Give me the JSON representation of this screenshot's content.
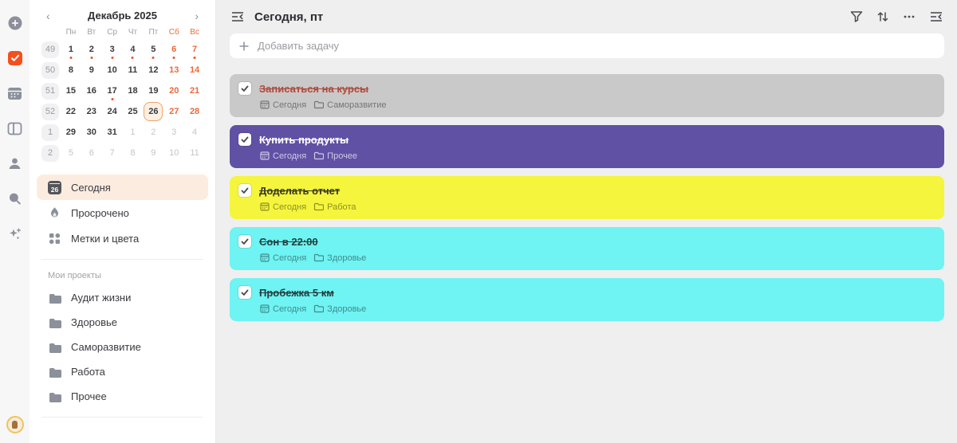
{
  "colors": {
    "accent_orange": "#f4501e",
    "weekend_orange": "#ec6a3a",
    "event_dot_red": "#e85230",
    "selected_day_border": "#f0a468",
    "selected_day_bg": "#fcf1e4",
    "today_nav_highlight": "#fcece0",
    "rail_bg": "#f7f7f8",
    "sidebar_bg": "#ffffff",
    "main_bg": "#efefef"
  },
  "rail": {
    "icons": [
      "add-circle-icon",
      "tasks-check-icon-active",
      "calendar-icon",
      "kanban-board-icon",
      "contacts-icon",
      "search-icon",
      "ai-sparkles-icon"
    ],
    "avatar": "user-avatar"
  },
  "calendar": {
    "title": "Декабрь 2025",
    "prev_glyph": "‹",
    "next_glyph": "›",
    "weekdays": [
      {
        "label": "Пн",
        "weekend": false
      },
      {
        "label": "Вт",
        "weekend": false
      },
      {
        "label": "Ср",
        "weekend": false
      },
      {
        "label": "Чт",
        "weekend": false
      },
      {
        "label": "Пт",
        "weekend": false
      },
      {
        "label": "Сб",
        "weekend": true
      },
      {
        "label": "Вс",
        "weekend": true
      }
    ],
    "weeks": [
      {
        "num": "49",
        "days": [
          {
            "d": "1",
            "dot": true
          },
          {
            "d": "2",
            "dot": true
          },
          {
            "d": "3",
            "dot": true
          },
          {
            "d": "4",
            "dot": true
          },
          {
            "d": "5",
            "dot": true
          },
          {
            "d": "6",
            "dot": true,
            "we": true
          },
          {
            "d": "7",
            "dot": true,
            "we": true
          }
        ]
      },
      {
        "num": "50",
        "days": [
          {
            "d": "8"
          },
          {
            "d": "9"
          },
          {
            "d": "10"
          },
          {
            "d": "11"
          },
          {
            "d": "12"
          },
          {
            "d": "13",
            "we": true
          },
          {
            "d": "14",
            "we": true
          }
        ]
      },
      {
        "num": "51",
        "days": [
          {
            "d": "15"
          },
          {
            "d": "16"
          },
          {
            "d": "17",
            "dot": true
          },
          {
            "d": "18"
          },
          {
            "d": "19"
          },
          {
            "d": "20",
            "we": true
          },
          {
            "d": "21",
            "we": true
          }
        ]
      },
      {
        "num": "52",
        "days": [
          {
            "d": "22"
          },
          {
            "d": "23"
          },
          {
            "d": "24"
          },
          {
            "d": "25"
          },
          {
            "d": "26",
            "sel": true
          },
          {
            "d": "27",
            "we": true
          },
          {
            "d": "28",
            "we": true
          }
        ]
      },
      {
        "num": "1",
        "days": [
          {
            "d": "29"
          },
          {
            "d": "30"
          },
          {
            "d": "31"
          },
          {
            "d": "1",
            "mu": true
          },
          {
            "d": "2",
            "mu": true
          },
          {
            "d": "3",
            "mu": true
          },
          {
            "d": "4",
            "mu": true
          }
        ]
      },
      {
        "num": "2",
        "days": [
          {
            "d": "5",
            "mu": true
          },
          {
            "d": "6",
            "mu": true
          },
          {
            "d": "7",
            "mu": true
          },
          {
            "d": "8",
            "mu": true
          },
          {
            "d": "9",
            "mu": true
          },
          {
            "d": "10",
            "mu": true
          },
          {
            "d": "11",
            "mu": true
          }
        ]
      }
    ]
  },
  "nav": {
    "today_label": "Сегодня",
    "today_badge": "26",
    "overdue_label": "Просрочено",
    "tags_label": "Метки и цвета"
  },
  "projects": {
    "header": "Мои проекты",
    "items": [
      "Аудит жизни",
      "Здоровье",
      "Саморазвитие",
      "Работа",
      "Прочее"
    ]
  },
  "main": {
    "title": "Сегодня, пт",
    "header_icons": [
      "sidebar-toggle-icon",
      "filter-icon",
      "sort-icon",
      "more-icon",
      "panel-collapse-icon"
    ],
    "add_placeholder": "Добавить задачу",
    "tasks": [
      {
        "title": "Записаться на курсы",
        "date": "Сегодня",
        "project": "Саморазвитие",
        "checked": true,
        "bg": "#c9c9c9",
        "title_color": "#b04a3e",
        "meta_color": "#757575"
      },
      {
        "title": "Купить продукты",
        "date": "Сегодня",
        "project": "Прочее",
        "checked": true,
        "bg": "#6051a5",
        "title_color": "#ffffff",
        "meta_color": "#cfc9e6"
      },
      {
        "title": "Доделать отчет",
        "date": "Сегодня",
        "project": "Работа",
        "checked": true,
        "bg": "#f5f53d",
        "title_color": "#38382b",
        "meta_color": "#8f8f24"
      },
      {
        "title": "Сон в 22:00",
        "date": "Сегодня",
        "project": "Здоровье",
        "checked": true,
        "bg": "#6ff3f3",
        "title_color": "#22403f",
        "meta_color": "#408c8c"
      },
      {
        "title": "Пробежка 5 км",
        "date": "Сегодня",
        "project": "Здоровье",
        "checked": true,
        "bg": "#6ff3f3",
        "title_color": "#22403f",
        "meta_color": "#408c8c"
      }
    ]
  }
}
